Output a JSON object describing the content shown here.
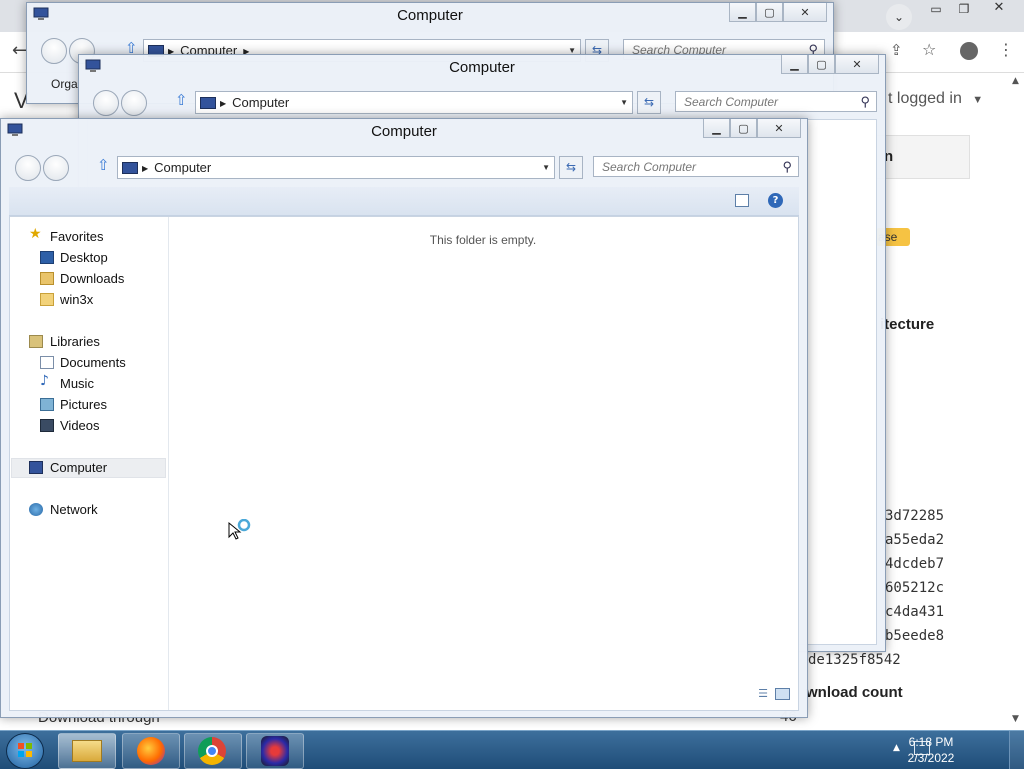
{
  "background_browser": {
    "left_fragment": "V",
    "account_text": "t logged in",
    "panel_heading_fragment": "n",
    "badge_fragment": "ase",
    "section_fragment": "itecture",
    "hashes": [
      "3d72285",
      "a55eda2",
      "4dcdeb7",
      "605212c",
      "c4da431",
      "b5eede8",
      "de1325f8542"
    ],
    "download_count_label": "wnload count",
    "download_count_value": "46",
    "download_through_label": "Download through"
  },
  "windows": {
    "back2": {
      "title": "Computer",
      "address": "Computer",
      "search_placeholder": "Search Computer",
      "organize_fragment": "Orga"
    },
    "back1": {
      "title": "Computer",
      "address": "Computer",
      "search_placeholder": "Search Computer"
    },
    "front": {
      "title": "Computer",
      "address": "Computer",
      "search_placeholder": "Search Computer",
      "empty_message": "This folder is empty.",
      "nav": {
        "favorites": "Favorites",
        "desktop": "Desktop",
        "downloads": "Downloads",
        "win3x": "win3x",
        "libraries": "Libraries",
        "documents": "Documents",
        "music": "Music",
        "pictures": "Pictures",
        "videos": "Videos",
        "computer": "Computer",
        "network": "Network"
      }
    }
  },
  "taskbar": {
    "time": "6:18 PM",
    "date": "2/3/2022",
    "apps": [
      "explorer-icon",
      "firefox-icon",
      "chrome-icon",
      "dosbox-icon"
    ]
  },
  "colors": {
    "taskbar": "#2b5a86",
    "window_frame": "#ebf0f8",
    "badge": "#f6c343",
    "selection": "#eceef1"
  }
}
